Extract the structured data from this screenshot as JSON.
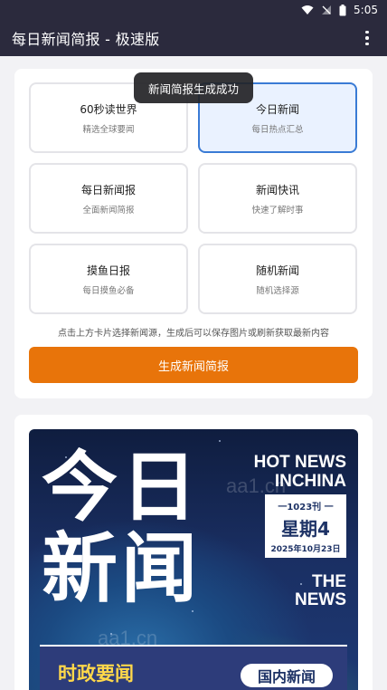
{
  "status_bar": {
    "time": "5:05"
  },
  "app_bar": {
    "title": "每日新闻简报 - 极速版"
  },
  "toast": "新闻简报生成成功",
  "sources": [
    {
      "title": "60秒读世界",
      "subtitle": "精选全球要闻",
      "selected": false
    },
    {
      "title": "今日新闻",
      "subtitle": "每日热点汇总",
      "selected": true
    },
    {
      "title": "每日新闻报",
      "subtitle": "全面新闻简报",
      "selected": false
    },
    {
      "title": "新闻快讯",
      "subtitle": "快速了解时事",
      "selected": false
    },
    {
      "title": "摸鱼日报",
      "subtitle": "每日摸鱼必备",
      "selected": false
    },
    {
      "title": "随机新闻",
      "subtitle": "随机选择源",
      "selected": false
    }
  ],
  "hint": "点击上方卡片选择新闻源，生成后可以保存图片或刷新获取最新内容",
  "generate_button": "生成新闻简报",
  "poster": {
    "big_line1": "今日",
    "big_line2": "新闻",
    "hot_line1": "HOT NEWS",
    "hot_line2": "INCHINA",
    "issue": "一1023刊 一",
    "weekday": "星期4",
    "date": "2025年10月23日",
    "the": "THE",
    "news": "NEWS",
    "watermark": "aa1.cn",
    "band_left": "时政要闻",
    "band_right": "国内新闻"
  },
  "colors": {
    "app_bar": "#2b2a3d",
    "accent": "#e8740a",
    "selected_border": "#3a7bd5",
    "selected_bg": "#eaf2ff"
  }
}
